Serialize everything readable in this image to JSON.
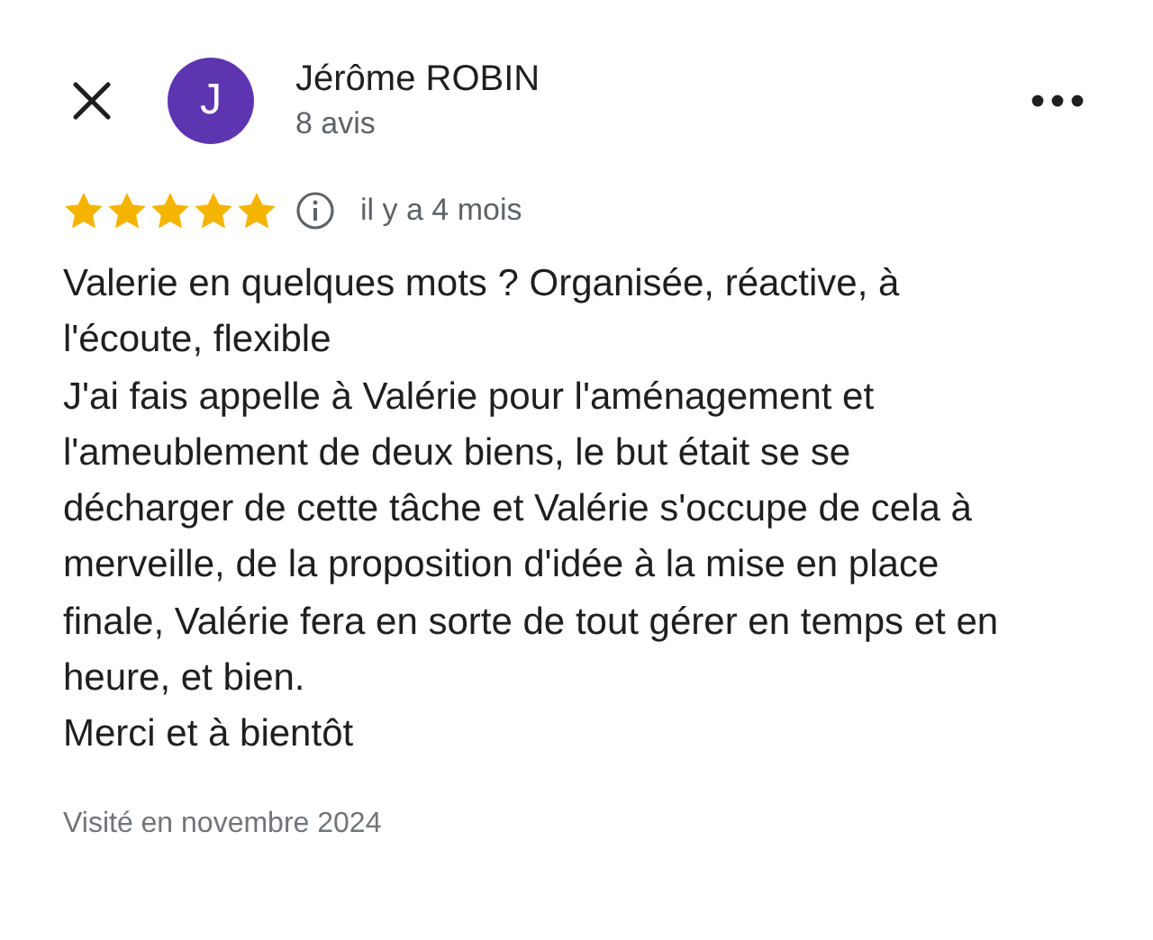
{
  "reviewer": {
    "initial": "J",
    "name": "Jérôme ROBIN",
    "count": "8 avis"
  },
  "review": {
    "stars": 5,
    "time": "il y a 4 mois",
    "paragraphs": [
      "Valerie en quelques mots ? Organisée, réactive, à l'écoute, flexible",
      "J'ai fais appelle à Valérie pour l'aménagement et l'ameublement de deux biens, le but était se se décharger de cette tâche et Valérie s'occupe de cela à merveille, de la proposition d'idée à la mise en place finale, Valérie fera en sorte de tout gérer en temps et en heure, et bien.",
      "Merci et à bientôt"
    ],
    "visited": "Visité en novembre 2024"
  }
}
